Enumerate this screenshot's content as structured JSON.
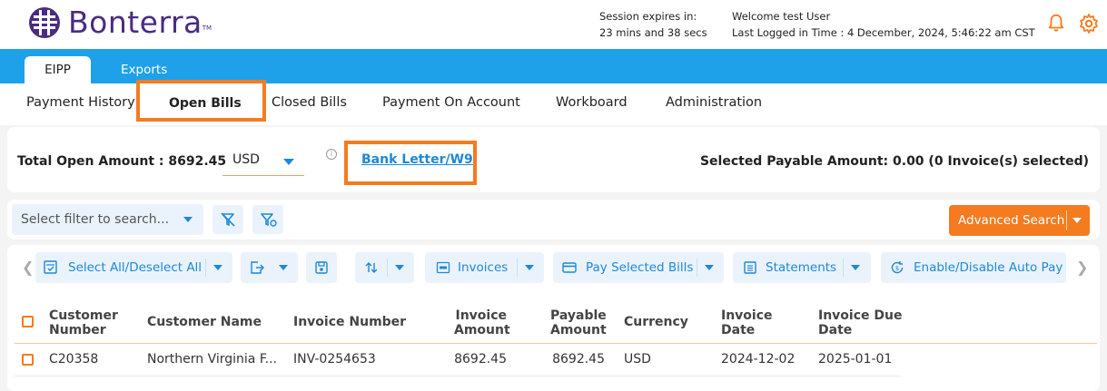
{
  "brand": {
    "name": "Bonterra",
    "tm": "TM",
    "accent": "#4a2b82"
  },
  "header": {
    "session_label": "Session expires in:",
    "session_value": "23 mins and 38 secs",
    "welcome": "Welcome test User",
    "last_logged": "Last Logged in Time : 4 December, 2024, 5:46:22 am CST",
    "icons": [
      "bell-icon",
      "gear-icon"
    ]
  },
  "tabs": [
    {
      "label": "EIPP",
      "active": true
    },
    {
      "label": "Exports",
      "active": false
    }
  ],
  "nav": [
    {
      "label": "Payment History"
    },
    {
      "label": "Open Bills",
      "active": true
    },
    {
      "label": "Closed Bills"
    },
    {
      "label": "Payment On Account"
    },
    {
      "label": "Workboard"
    },
    {
      "label": "Administration"
    }
  ],
  "summary": {
    "total_label": "Total Open Amount : 8692.45",
    "currency": "USD",
    "info": "i",
    "bank_link": "Bank Letter/W9",
    "selected_payable": "Selected Payable Amount: 0.00 (0 Invoice(s) selected)"
  },
  "filter": {
    "placeholder": "Select filter to search...",
    "advanced_search": "Advanced Search"
  },
  "toolbar": {
    "select_all": "Select All/Deselect All",
    "invoices": "Invoices",
    "pay_selected": "Pay Selected Bills",
    "statements": "Statements",
    "auto_pay": "Enable/Disable Auto Pay"
  },
  "table": {
    "headers": {
      "customer_number_1": "Customer",
      "customer_number_2": "Number",
      "customer_name": "Customer Name",
      "invoice_number": "Invoice Number",
      "invoice_amount_1": "Invoice",
      "invoice_amount_2": "Amount",
      "payable_amount_1": "Payable",
      "payable_amount_2": "Amount",
      "currency": "Currency",
      "invoice_date_1": "Invoice",
      "invoice_date_2": "Date",
      "invoice_due_1": "Invoice Due",
      "invoice_due_2": "Date"
    },
    "rows": [
      {
        "customer_number": "C20358",
        "customer_name": "Northern Virginia F...",
        "invoice_number": "INV-0254653",
        "invoice_amount": "8692.45",
        "payable_amount": "8692.45",
        "currency": "USD",
        "invoice_date": "2024-12-02",
        "invoice_due_date": "2025-01-01"
      }
    ]
  },
  "colors": {
    "primary": "#1ea1e8",
    "accent": "#f47b20",
    "link": "#1e88d8"
  }
}
